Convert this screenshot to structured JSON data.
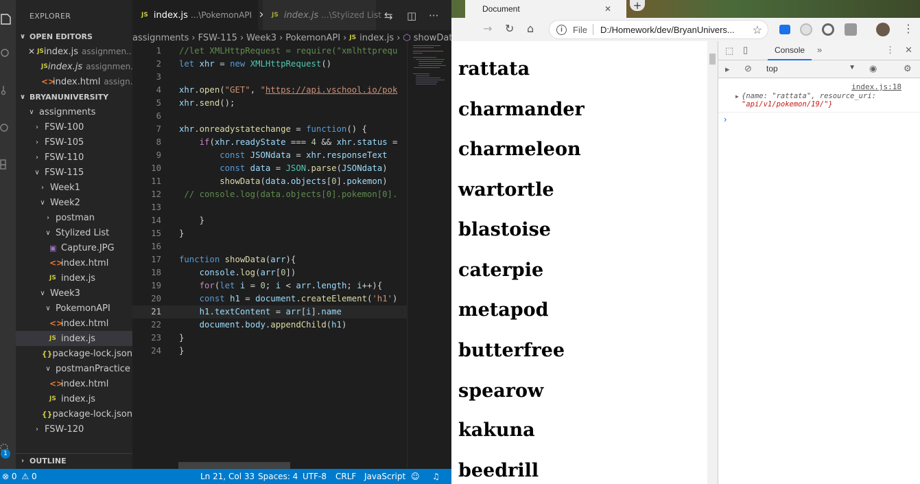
{
  "vscode": {
    "explorer_title": "EXPLORER",
    "open_editors_title": "OPEN EDITORS",
    "open_editors": [
      {
        "name": "index.js",
        "desc": "assignmen...",
        "type": "js",
        "closable": true,
        "italic": false
      },
      {
        "name": "index.js",
        "desc": "assignmen...",
        "type": "js",
        "closable": false,
        "italic": true
      },
      {
        "name": "index.html",
        "desc": "assign...",
        "type": "html",
        "closable": false,
        "italic": false
      }
    ],
    "workspace_title": "BRYANUNIVERSITY",
    "tree": [
      {
        "label": "assignments",
        "type": "folder-open"
      },
      {
        "label": "FSW-100",
        "type": "folder"
      },
      {
        "label": "FSW-105",
        "type": "folder"
      },
      {
        "label": "FSW-110",
        "type": "folder"
      },
      {
        "label": "FSW-115",
        "type": "folder-open"
      },
      {
        "label": "Week1",
        "type": "folder"
      },
      {
        "label": "Week2",
        "type": "folder-open"
      },
      {
        "label": "postman",
        "type": "folder"
      },
      {
        "label": "Stylized List",
        "type": "folder-open"
      },
      {
        "label": "Capture.JPG",
        "type": "img"
      },
      {
        "label": "index.html",
        "type": "html"
      },
      {
        "label": "index.js",
        "type": "js"
      },
      {
        "label": "Week3",
        "type": "folder-open"
      },
      {
        "label": "PokemonAPI",
        "type": "folder-open"
      },
      {
        "label": "index.html",
        "type": "html"
      },
      {
        "label": "index.js",
        "type": "js"
      },
      {
        "label": "package-lock.json",
        "type": "json"
      },
      {
        "label": "postmanPractice",
        "type": "folder-open"
      },
      {
        "label": "index.html",
        "type": "html"
      },
      {
        "label": "index.js",
        "type": "js"
      },
      {
        "label": "package-lock.json",
        "type": "json"
      },
      {
        "label": "FSW-120",
        "type": "folder"
      }
    ],
    "outline_title": "OUTLINE",
    "badge_count": "1",
    "tabs": [
      {
        "name": "index.js",
        "desc": "...\\PokemonAPI",
        "close": "✕"
      },
      {
        "name": "index.js",
        "desc": "...\\Stylized List"
      }
    ],
    "breadcrumb": [
      "assignments",
      "FSW-115",
      "Week3",
      "PokemonAPI",
      "index.js",
      "showData"
    ],
    "status": {
      "errors": "0",
      "warnings": "0",
      "position": "Ln 21, Col 33",
      "spaces": "Spaces: 4",
      "encoding": "UTF-8",
      "eol": "CRLF",
      "language": "JavaScript"
    },
    "line_numbers": [
      "1",
      "2",
      "3",
      "4",
      "5",
      "6",
      "7",
      "8",
      "9",
      "10",
      "11",
      "12",
      "13",
      "14",
      "15",
      "16",
      "17",
      "18",
      "19",
      "20",
      "21",
      "22",
      "23",
      "24"
    ]
  },
  "chrome": {
    "tab_title": "Document",
    "omnibox_scheme": "File",
    "omnibox_url": "D:/Homework/dev/BryanUnivers...",
    "page_items": [
      "rattata",
      "charmander",
      "charmeleon",
      "wartortle",
      "blastoise",
      "caterpie",
      "metapod",
      "butterfree",
      "spearow",
      "kakuna",
      "beedrill"
    ],
    "devtools": {
      "console_tab": "Console",
      "more_tabs": "»",
      "context": "top",
      "log_source": "index.js:18",
      "log_line1": "{name: \"rattata\", resource_uri:",
      "log_line2": "\"api/v1/pokemon/19/\"}",
      "prompt": "›"
    }
  }
}
